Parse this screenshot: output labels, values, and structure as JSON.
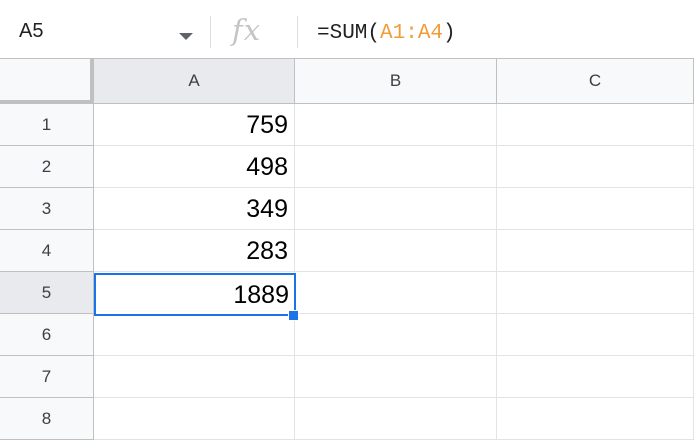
{
  "name_box": {
    "cell_ref": "A5",
    "dropdown_icon": "caret-down-icon"
  },
  "formula_bar": {
    "fx_label": "fx",
    "formula_prefix": "=SUM(",
    "formula_range": "A1:A4",
    "formula_suffix": ")"
  },
  "columns": [
    "A",
    "B",
    "C"
  ],
  "rows": [
    "1",
    "2",
    "3",
    "4",
    "5",
    "6",
    "7",
    "8"
  ],
  "cells": {
    "A1": "759",
    "A2": "498",
    "A3": "349",
    "A4": "283",
    "A5": "1889"
  },
  "colors": {
    "selection": "#1a73e8",
    "range_highlight": "#f29c38",
    "header_bg": "#f8f9fa",
    "header_selected_bg": "#e8eaed"
  }
}
